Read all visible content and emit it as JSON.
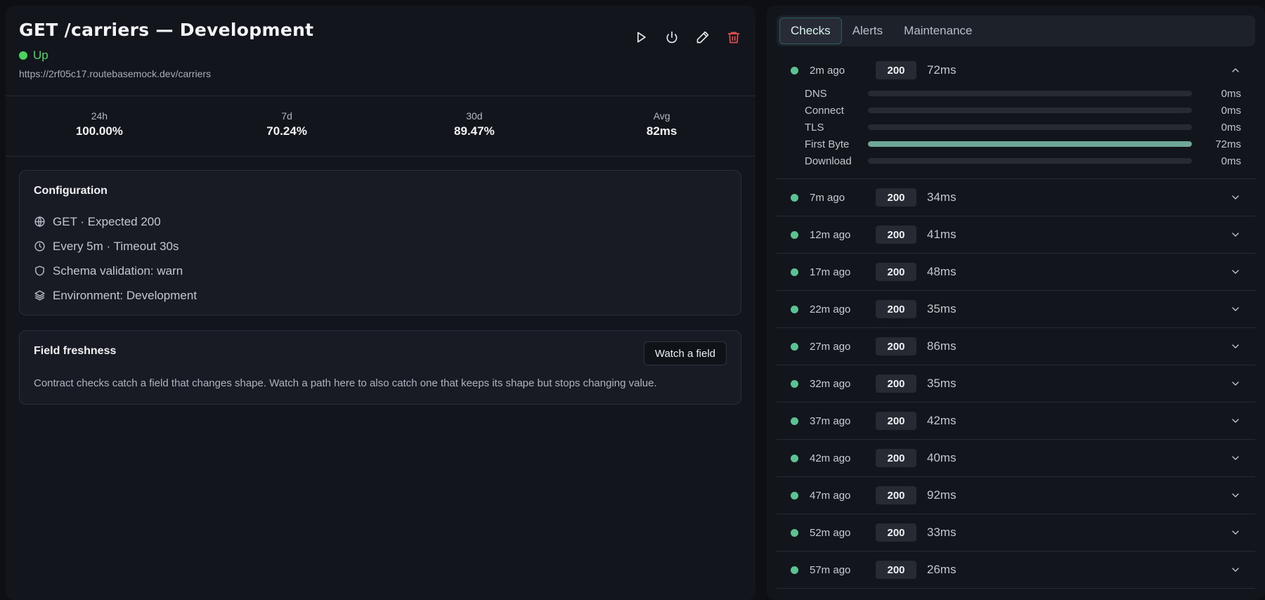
{
  "header": {
    "title": "GET /carriers — Development",
    "status": "Up",
    "url": "https://2rf05c17.routebasemock.dev/carriers"
  },
  "colors": {
    "status_up": "#4ad25f",
    "delete": "#e0504f",
    "check_ok": "#5cc293",
    "bar_fill": "#6fa897"
  },
  "actions": [
    {
      "name": "run-check-button",
      "icon": "play-icon"
    },
    {
      "name": "pause-button",
      "icon": "power-icon"
    },
    {
      "name": "edit-button",
      "icon": "pencil-icon"
    },
    {
      "name": "delete-button",
      "icon": "trash-icon"
    }
  ],
  "stats": [
    {
      "label": "24h",
      "value": "100.00%"
    },
    {
      "label": "7d",
      "value": "70.24%"
    },
    {
      "label": "30d",
      "value": "89.47%"
    },
    {
      "label": "Avg",
      "value": "82ms"
    }
  ],
  "config": {
    "title": "Configuration",
    "items": [
      {
        "icon": "globe-icon",
        "text": "GET · Expected 200"
      },
      {
        "icon": "clock-icon",
        "text": "Every 5m · Timeout 30s"
      },
      {
        "icon": "shield-icon",
        "text": "Schema validation: warn"
      },
      {
        "icon": "layers-icon",
        "text": "Environment: Development"
      }
    ]
  },
  "freshness": {
    "title": "Field freshness",
    "button": "Watch a field",
    "description": "Contract checks catch a field that changes shape. Watch a path here to also catch one that keeps its shape but stops changing value."
  },
  "tabs": [
    {
      "label": "Checks",
      "active": true
    },
    {
      "label": "Alerts",
      "active": false
    },
    {
      "label": "Maintenance",
      "active": false
    }
  ],
  "checks": [
    {
      "ago": "2m ago",
      "code": "200",
      "ms": "72ms",
      "expanded": true,
      "timings": [
        {
          "label": "DNS",
          "value": "0ms",
          "fraction": 0
        },
        {
          "label": "Connect",
          "value": "0ms",
          "fraction": 0
        },
        {
          "label": "TLS",
          "value": "0ms",
          "fraction": 0
        },
        {
          "label": "First Byte",
          "value": "72ms",
          "fraction": 1
        },
        {
          "label": "Download",
          "value": "0ms",
          "fraction": 0
        }
      ]
    },
    {
      "ago": "7m ago",
      "code": "200",
      "ms": "34ms"
    },
    {
      "ago": "12m ago",
      "code": "200",
      "ms": "41ms"
    },
    {
      "ago": "17m ago",
      "code": "200",
      "ms": "48ms"
    },
    {
      "ago": "22m ago",
      "code": "200",
      "ms": "35ms"
    },
    {
      "ago": "27m ago",
      "code": "200",
      "ms": "86ms"
    },
    {
      "ago": "32m ago",
      "code": "200",
      "ms": "35ms"
    },
    {
      "ago": "37m ago",
      "code": "200",
      "ms": "42ms"
    },
    {
      "ago": "42m ago",
      "code": "200",
      "ms": "40ms"
    },
    {
      "ago": "47m ago",
      "code": "200",
      "ms": "92ms"
    },
    {
      "ago": "52m ago",
      "code": "200",
      "ms": "33ms"
    },
    {
      "ago": "57m ago",
      "code": "200",
      "ms": "26ms"
    }
  ]
}
